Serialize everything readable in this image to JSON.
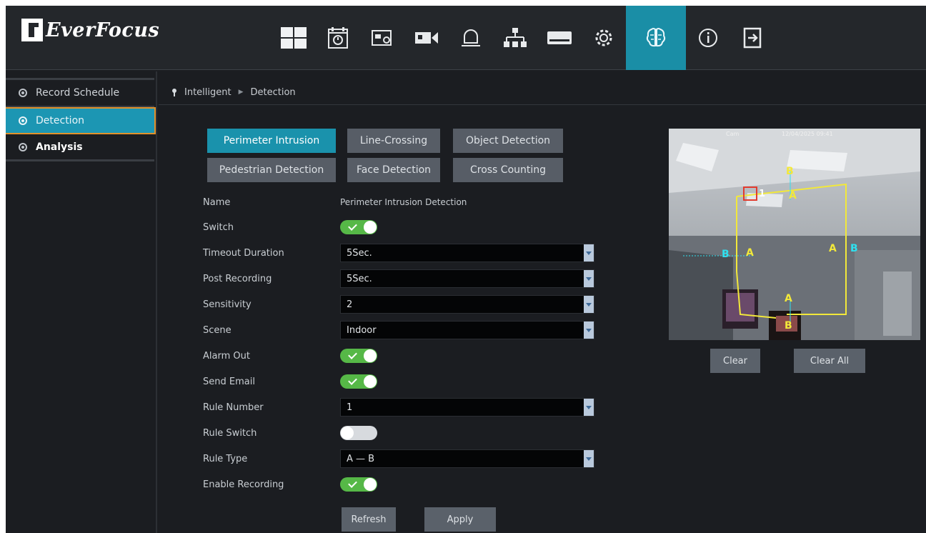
{
  "brand": {
    "name": "EverFocus"
  },
  "topnav": [
    {
      "icon": "live-view-grid-icon",
      "active": false
    },
    {
      "icon": "playback-icon",
      "active": false
    },
    {
      "icon": "snapshot-settings-icon",
      "active": false
    },
    {
      "icon": "camera-icon",
      "active": false
    },
    {
      "icon": "alarm-bell-icon",
      "active": false
    },
    {
      "icon": "network-icon",
      "active": false
    },
    {
      "icon": "storage-icon",
      "active": false
    },
    {
      "icon": "settings-gear-icon",
      "active": false
    },
    {
      "icon": "intelligent-brain-icon",
      "active": true
    },
    {
      "icon": "info-icon",
      "active": false
    },
    {
      "icon": "logout-icon",
      "active": false
    }
  ],
  "sidebar": {
    "items": [
      {
        "label": "Record Schedule"
      },
      {
        "label": "Detection"
      },
      {
        "label": "Analysis"
      }
    ]
  },
  "breadcrumb": {
    "root": "Intelligent",
    "current": "Detection"
  },
  "tabs": [
    {
      "label": "Perimeter Intrusion"
    },
    {
      "label": "Line-Crossing"
    },
    {
      "label": "Object Detection"
    },
    {
      "label": "Pedestrian Detection"
    },
    {
      "label": "Face Detection"
    },
    {
      "label": "Cross Counting"
    }
  ],
  "form": {
    "name_label": "Name",
    "name_value": "Perimeter Intrusion Detection",
    "switch_label": "Switch",
    "timeout_label": "Timeout Duration",
    "timeout_value": "5Sec.",
    "post_recording_label": "Post Recording",
    "post_recording_value": "5Sec.",
    "sensitivity_label": "Sensitivity",
    "sensitivity_value": "2",
    "scene_label": "Scene",
    "scene_value": "Indoor",
    "alarm_out_label": "Alarm Out",
    "send_email_label": "Send Email",
    "rule_number_label": "Rule Number",
    "rule_number_value": "1",
    "rule_switch_label": "Rule Switch",
    "rule_type_label": "Rule Type",
    "rule_type_value": "A — B",
    "enable_recording_label": "Enable Recording"
  },
  "buttons": {
    "refresh": "Refresh",
    "apply": "Apply",
    "clear": "Clear",
    "clear_all": "Clear All"
  },
  "preview": {
    "timestamp_left": "Cam",
    "timestamp_right": "12/04/2025 09:41",
    "rule_marker": "1",
    "labels": {
      "a": "A",
      "b": "B"
    }
  },
  "colors": {
    "accent": "#1a92ac",
    "active_sidebar_border": "#e2912a",
    "toggle_on": "#56b847",
    "rule_line": "#f2e83a",
    "rule_label_cyan": "#2fe0ef"
  }
}
